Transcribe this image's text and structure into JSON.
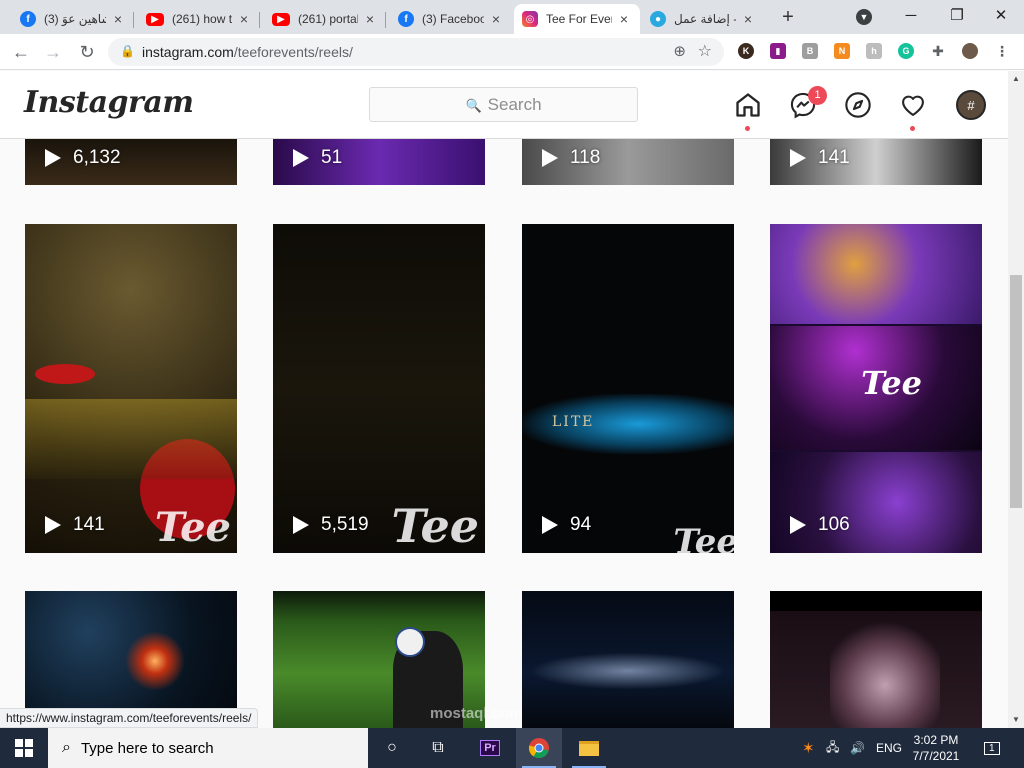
{
  "browser": {
    "tabs": [
      {
        "title": "(3) شاهين عوَ",
        "icon": "facebook-icon",
        "close": "×"
      },
      {
        "title": "(261) how to",
        "icon": "youtube-icon",
        "close": "×"
      },
      {
        "title": "(261) portab",
        "icon": "youtube-icon",
        "close": "×"
      },
      {
        "title": "(3) Faceboo",
        "icon": "facebook-icon",
        "close": "×"
      },
      {
        "title": "Tee For Even",
        "icon": "instagram-icon",
        "close": "×"
      },
      {
        "title": "إضافة عمل -",
        "icon": "mostaql-icon",
        "close": "×"
      }
    ],
    "new_tab": "+",
    "url_host": "instagram.com",
    "url_path": "/teeforevents/reels/",
    "status_url": "https://www.instagram.com/teeforevents/reels/"
  },
  "instagram": {
    "logo": "Instagram",
    "search_placeholder": "Search",
    "messenger_badge": "1"
  },
  "reels": {
    "row1": [
      "6,132",
      "51",
      "118",
      "141"
    ],
    "row2": [
      "141",
      "5,519",
      "94",
      "106"
    ],
    "brand_mark": "Tee",
    "elite_text": "LITE"
  },
  "watermark": "mostaql.com",
  "taskbar": {
    "search_placeholder": "Type here to search",
    "lang": "ENG",
    "time": "3:02 PM",
    "date": "7/7/2021",
    "notifications": "1"
  },
  "colors": {
    "instagram_red": "#ed4956",
    "chrome_tabstrip": "#dee1e6",
    "taskbar": "#1f2a3c"
  }
}
